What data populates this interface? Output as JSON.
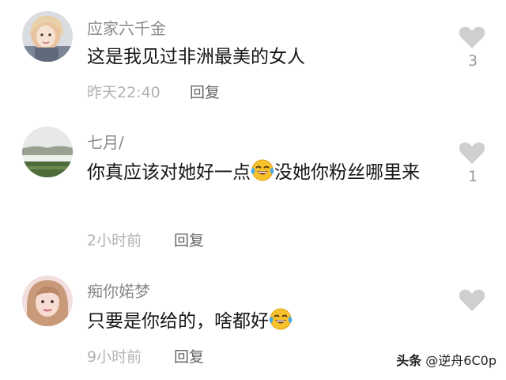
{
  "comments": [
    {
      "username": "应家六千金",
      "text": "这是我见过非洲最美的女人",
      "time": "昨天22:40",
      "reply_label": "回复",
      "likes": "3",
      "avatar_icon": "girl-portrait-avatar-icon"
    },
    {
      "username": "七月/",
      "text_before": "你真应该对她好一点",
      "text_after": "没她你粉丝哪里来",
      "emoji_icon": "tears-of-joy-emoji-icon",
      "time": "2小时前",
      "reply_label": "回复",
      "likes": "1",
      "avatar_icon": "landscape-avatar-icon"
    },
    {
      "username": "痴你婼梦",
      "text_before": "只要是你给的，啥都好",
      "emoji_icon": "tears-of-joy-emoji-icon",
      "time": "9小时前",
      "reply_label": "回复",
      "likes": "",
      "avatar_icon": "woman-selfie-avatar-icon"
    }
  ],
  "watermark": {
    "brand": "头条",
    "handle": "@逆舟6C0p"
  },
  "colors": {
    "username": "#8a8a8a",
    "text": "#161616",
    "meta": "#b3b3b3",
    "like_icon": "#cfcfcf"
  }
}
